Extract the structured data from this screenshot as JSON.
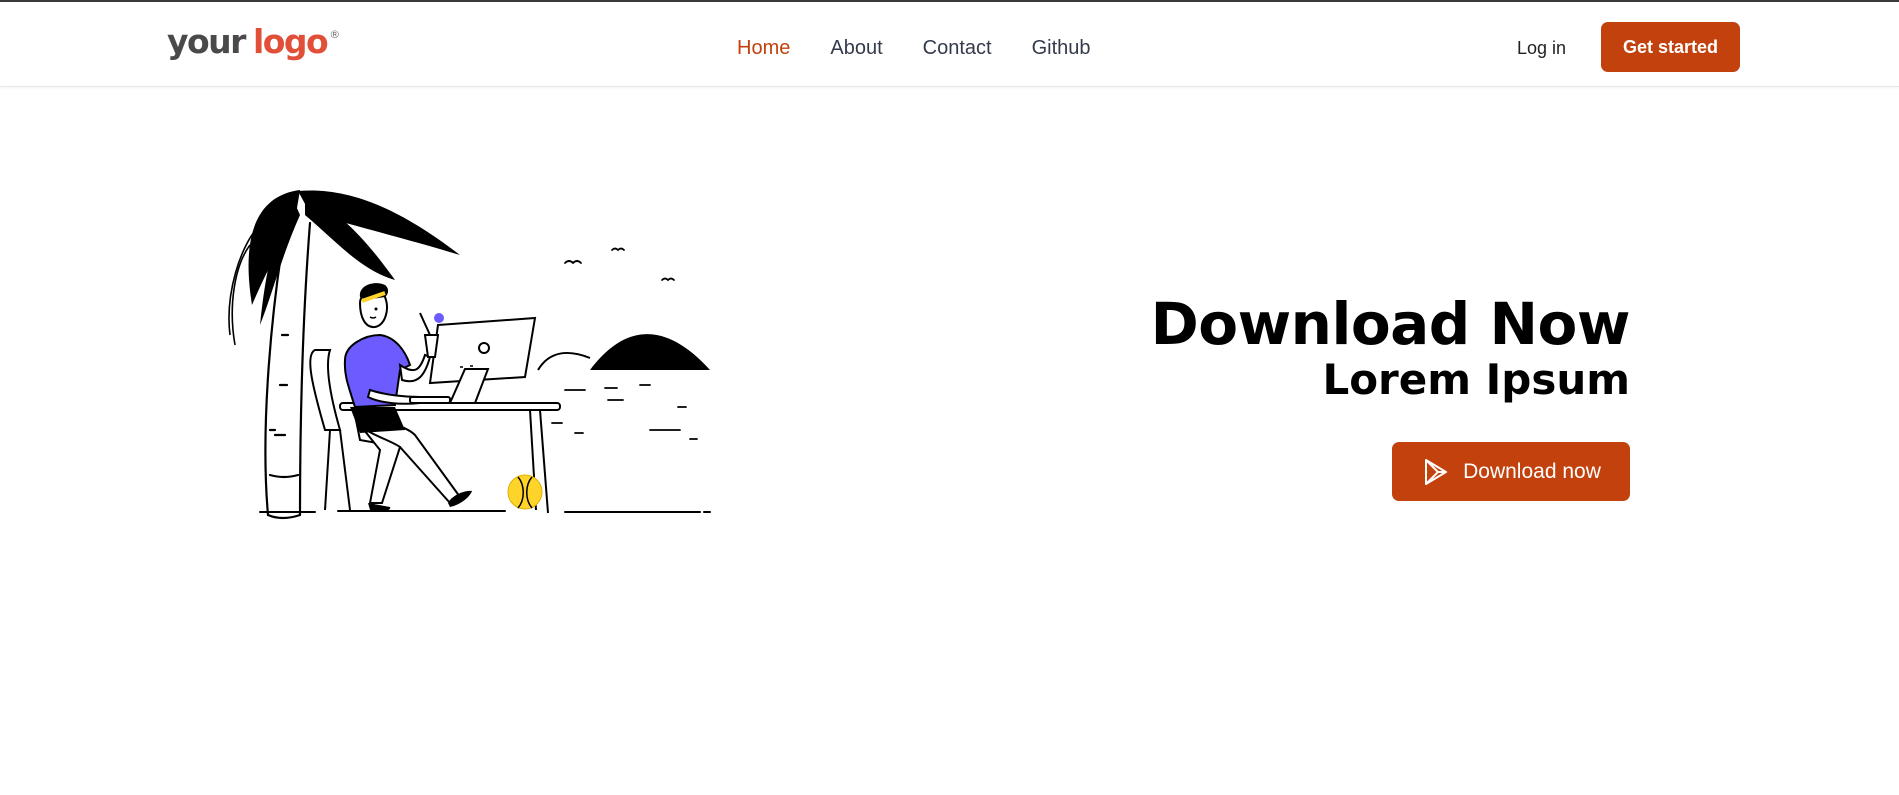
{
  "header": {
    "logo": {
      "word1": "your",
      "word2": "logo",
      "mark": "®"
    },
    "nav": [
      {
        "label": "Home",
        "active": true
      },
      {
        "label": "About",
        "active": false
      },
      {
        "label": "Contact",
        "active": false
      },
      {
        "label": "Github",
        "active": false
      }
    ],
    "login_label": "Log in",
    "cta_label": "Get started"
  },
  "hero": {
    "title": "Download Now",
    "subtitle": "Lorem Ipsum",
    "download_label": "Download now",
    "download_icon": "play-store-icon"
  },
  "colors": {
    "accent": "#c2410c",
    "logo_red": "#e14f38",
    "illustration_purple": "#6c5cff",
    "ball_yellow": "#ffd42a"
  }
}
